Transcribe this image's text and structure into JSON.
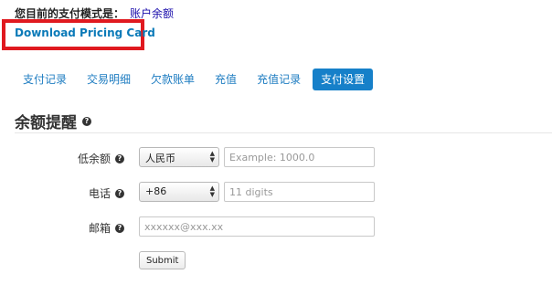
{
  "payment_mode": {
    "label": "您目前的支付模式是：",
    "value": "账户余额"
  },
  "download_link": "Download Pricing Card",
  "tabs": [
    {
      "label": "支付记录",
      "active": false
    },
    {
      "label": "交易明细",
      "active": false
    },
    {
      "label": "欠款账单",
      "active": false
    },
    {
      "label": "充值",
      "active": false
    },
    {
      "label": "充值记录",
      "active": false
    },
    {
      "label": "支付设置",
      "active": true
    }
  ],
  "section": {
    "title": "余额提醒",
    "help_icon": "question-circle-icon"
  },
  "form": {
    "low_balance": {
      "label": "低余额",
      "currency": "人民币",
      "placeholder": "Example: 1000.0"
    },
    "phone": {
      "label": "电话",
      "country_code": "+86",
      "placeholder": "11 digits"
    },
    "email": {
      "label": "邮箱",
      "placeholder": "xxxxxx@xxx.xx"
    },
    "submit_label": "Submit"
  },
  "colors": {
    "link": "#0b7ab8",
    "active_tab": "#1680c9",
    "highlight": "#e0191f"
  }
}
